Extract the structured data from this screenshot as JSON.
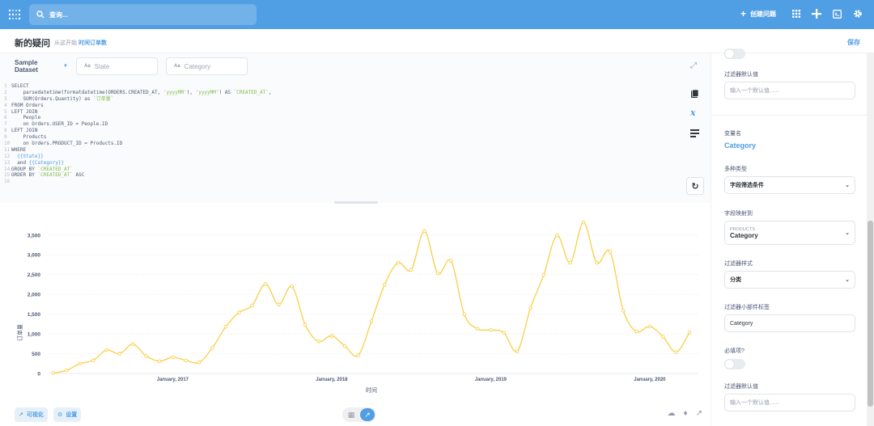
{
  "topbar": {
    "search_placeholder": "查询...",
    "new_question": "创建问题"
  },
  "header": {
    "title": "新的疑问",
    "subtitle_prefix": "从这开始",
    "subtitle_link": "时间订单数",
    "save": "保存"
  },
  "editor": {
    "dataset": "Sample Dataset",
    "state_placeholder": "State",
    "category_placeholder": "Category",
    "lines": [
      {
        "n": "1",
        "parts": [
          {
            "t": "SELECT",
            "c": "kw"
          }
        ]
      },
      {
        "n": "2",
        "parts": [
          {
            "t": "    parsedatetime(formatdatetime(ORDERS.CREATED_AT, ",
            "c": "kw"
          },
          {
            "t": "'yyyyMM'",
            "c": "str"
          },
          {
            "t": "), ",
            "c": "kw"
          },
          {
            "t": "'yyyyMM'",
            "c": "str"
          },
          {
            "t": ") AS ",
            "c": "kw"
          },
          {
            "t": "`CREATED_AT`",
            "c": "str"
          },
          {
            "t": ",",
            "c": "kw"
          }
        ]
      },
      {
        "n": "3",
        "parts": [
          {
            "t": "    SUM(Orders.Quantity) as ",
            "c": "kw"
          },
          {
            "t": "`订单量`",
            "c": "str"
          }
        ]
      },
      {
        "n": "4",
        "parts": [
          {
            "t": "FROM Orders",
            "c": "kw"
          }
        ]
      },
      {
        "n": "5",
        "parts": [
          {
            "t": "LEFT JOIN",
            "c": "kw"
          }
        ]
      },
      {
        "n": "6",
        "parts": [
          {
            "t": "    People",
            "c": "kw"
          }
        ]
      },
      {
        "n": "7",
        "parts": [
          {
            "t": "    on Orders.USER_ID = People.ID",
            "c": "kw"
          }
        ]
      },
      {
        "n": "8",
        "parts": [
          {
            "t": "LEFT JOIN",
            "c": "kw"
          }
        ]
      },
      {
        "n": "9",
        "parts": [
          {
            "t": "    Products",
            "c": "kw"
          }
        ]
      },
      {
        "n": "10",
        "parts": [
          {
            "t": "    on Orders.PRODUCT_ID = Products.ID",
            "c": "kw"
          }
        ]
      },
      {
        "n": "11",
        "parts": [
          {
            "t": "WHERE",
            "c": "kw"
          }
        ]
      },
      {
        "n": "12",
        "parts": [
          {
            "t": "  {{State}}",
            "c": "var"
          }
        ]
      },
      {
        "n": "13",
        "parts": [
          {
            "t": "  and ",
            "c": "kw"
          },
          {
            "t": "{{Category}}",
            "c": "var"
          }
        ]
      },
      {
        "n": "14",
        "parts": [
          {
            "t": "GROUP BY ",
            "c": "kw"
          },
          {
            "t": "`CREATED_AT`",
            "c": "str"
          }
        ]
      },
      {
        "n": "15",
        "parts": [
          {
            "t": "ORDER BY ",
            "c": "kw"
          },
          {
            "t": "`CREATED_AT`",
            "c": "str"
          },
          {
            "t": " ASC",
            "c": "kw"
          }
        ]
      },
      {
        "n": "16",
        "parts": []
      }
    ]
  },
  "footer": {
    "visualize": "可视化",
    "settings": "设置"
  },
  "right_panel": {
    "top_default_label": "过滤器默认值",
    "top_default_placeholder": "输入一个默认值......",
    "var_name_label": "变量名",
    "var_name_value": "Category",
    "type_label": "多种类型",
    "type_value": "字段筛选条件",
    "mapping_label": "字段映射到",
    "mapping_table": "PRODUCTS",
    "mapping_field": "Category",
    "widget_label": "过滤器样式",
    "widget_value": "分类",
    "widget_label_label": "过滤器小部件标签",
    "widget_label_value": "Category",
    "required_label": "必填项?",
    "bottom_default_label": "过滤器默认值",
    "bottom_default_placeholder": "输入一个默认值......"
  },
  "chart_data": {
    "type": "line",
    "color": "#f9cf48",
    "xlabel": "时间",
    "ylabel": "订单量",
    "ylim": [
      0,
      3700
    ],
    "yticks": [
      0,
      500,
      1000,
      1500,
      2000,
      2500,
      3000,
      3500
    ],
    "ytick_labels": [
      "0",
      "500",
      "1,000",
      "1,500",
      "2,000",
      "2,500",
      "3,000",
      "3,500"
    ],
    "xticks": [
      {
        "index": 9,
        "label": "January, 2017"
      },
      {
        "index": 21,
        "label": "January, 2018"
      },
      {
        "index": 33,
        "label": "January, 2019"
      },
      {
        "index": 45,
        "label": "January, 2020"
      }
    ],
    "x": [
      "2016-04",
      "2016-05",
      "2016-06",
      "2016-07",
      "2016-08",
      "2016-09",
      "2016-10",
      "2016-11",
      "2016-12",
      "2017-01",
      "2017-02",
      "2017-03",
      "2017-04",
      "2017-05",
      "2017-06",
      "2017-07",
      "2017-08",
      "2017-09",
      "2017-10",
      "2017-11",
      "2017-12",
      "2018-01",
      "2018-02",
      "2018-03",
      "2018-04",
      "2018-05",
      "2018-06",
      "2018-07",
      "2018-08",
      "2018-09",
      "2018-10",
      "2018-11",
      "2018-12",
      "2019-01",
      "2019-02",
      "2019-03",
      "2019-04",
      "2019-05",
      "2019-06",
      "2019-07",
      "2019-08",
      "2019-09",
      "2019-10",
      "2019-11",
      "2019-12",
      "2020-01",
      "2020-02",
      "2020-03",
      "2020-04"
    ],
    "values": [
      10,
      80,
      250,
      330,
      590,
      500,
      740,
      440,
      310,
      410,
      330,
      280,
      650,
      1180,
      1540,
      1720,
      2260,
      1740,
      2200,
      1230,
      810,
      950,
      690,
      460,
      1320,
      2250,
      2800,
      2620,
      3600,
      2530,
      2850,
      1500,
      1130,
      1100,
      1030,
      560,
      1650,
      2490,
      3490,
      2800,
      3820,
      2800,
      3080,
      1590,
      1060,
      1190,
      930,
      540,
      1040
    ]
  }
}
